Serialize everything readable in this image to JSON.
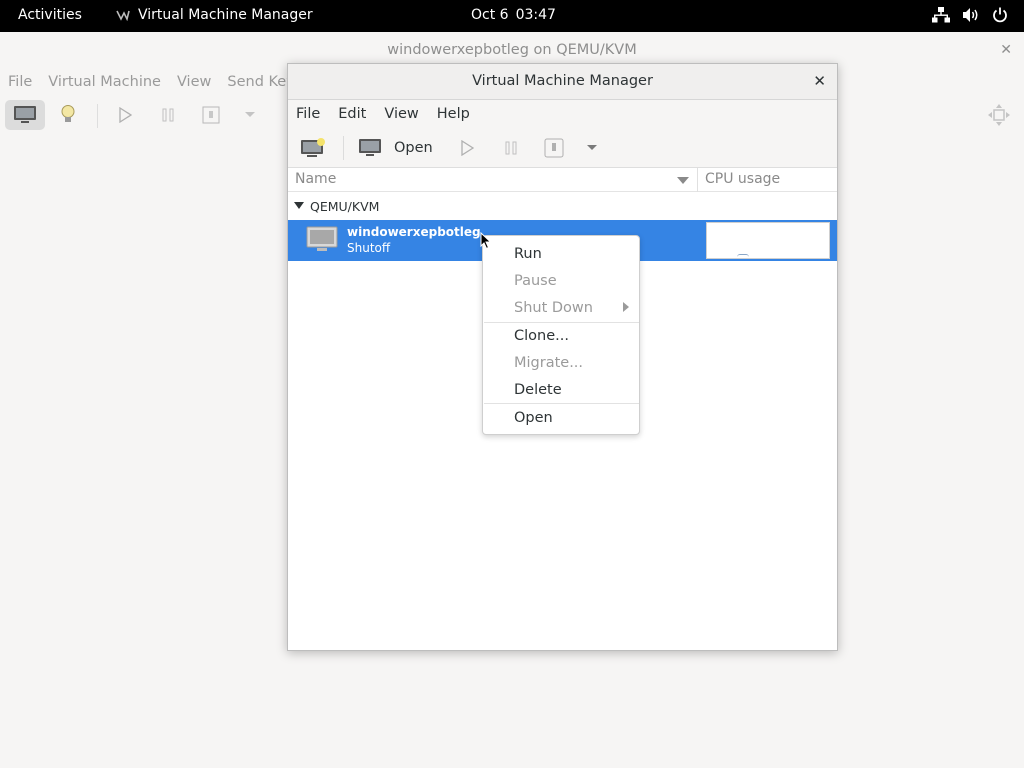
{
  "topbar": {
    "activities": "Activities",
    "app_name": "Virtual Machine Manager",
    "date": "Oct 6",
    "time": "03:47",
    "icons": [
      "network-icon",
      "volume-icon",
      "power-icon"
    ]
  },
  "console_window": {
    "title": "windowerxepbotleg on QEMU/KVM",
    "menu": [
      "File",
      "Virtual Machine",
      "View",
      "Send Key"
    ]
  },
  "manager": {
    "title": "Virtual Machine Manager",
    "menu": [
      "File",
      "Edit",
      "View",
      "Help"
    ],
    "toolbar": {
      "open_label": "Open"
    },
    "columns": {
      "name": "Name",
      "cpu": "CPU usage"
    },
    "group": "QEMU/KVM",
    "vm": {
      "name": "windowerxepbotleg",
      "state": "Shutoff"
    },
    "selection_color": "#3584e4"
  },
  "context_menu": {
    "items": [
      {
        "label": "Run",
        "enabled": true
      },
      {
        "label": "Pause",
        "enabled": false
      },
      {
        "label": "Shut Down",
        "enabled": false,
        "submenu": true
      },
      {
        "label": "Clone...",
        "enabled": true
      },
      {
        "label": "Migrate...",
        "enabled": false
      },
      {
        "label": "Delete",
        "enabled": true
      },
      {
        "label": "Open",
        "enabled": true
      }
    ]
  }
}
